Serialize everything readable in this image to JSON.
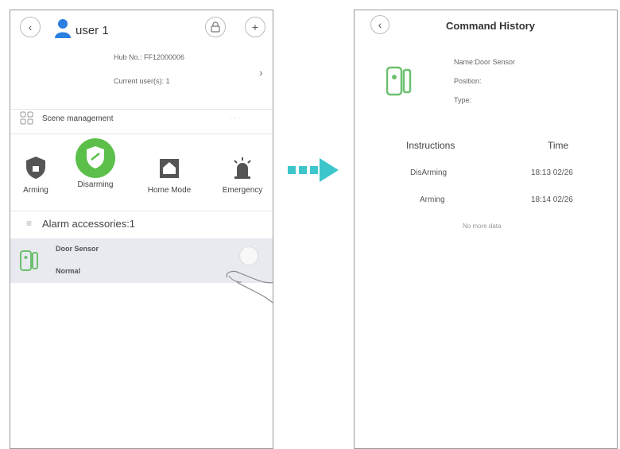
{
  "left_screen": {
    "header": {
      "back_icon": "chevron-left",
      "user_name": "user 1",
      "device_icon": "lock-icon",
      "add_icon": "plus"
    },
    "hub_info": {
      "hub_no": "Hub No.: FF12000006",
      "current_users": "Current user(s): 1"
    },
    "scene_management": {
      "label": "Scene management"
    },
    "modes": [
      {
        "label": "Arming",
        "icon": "shield-lock-icon"
      },
      {
        "label": "Disarming",
        "icon": "shield-open-icon",
        "active": true
      },
      {
        "label": "Home Mode",
        "icon": "home-icon"
      },
      {
        "label": "Emergency",
        "icon": "alarm-light-icon"
      }
    ],
    "alarm_accessories": {
      "label": "Alarm accessories:1"
    },
    "accessory": {
      "name": "Door Sensor",
      "status": "Normal"
    }
  },
  "right_screen": {
    "header": {
      "back_icon": "chevron-left",
      "title": "Command History"
    },
    "device_info": {
      "name": "Name:Door Sensor",
      "position": "Position:",
      "type": "Type:"
    },
    "table": {
      "headers": [
        "Instructions",
        "Time"
      ],
      "rows": [
        [
          "DisArming",
          "18:13 02/26"
        ],
        [
          "Arming",
          "18:14 02/26"
        ]
      ],
      "footer": "No more data"
    }
  },
  "colors": {
    "accent": "#3cc6cc",
    "green": "#6cc070",
    "active_green": "#5bbf4a",
    "user_blue": "#2a7fe0"
  }
}
